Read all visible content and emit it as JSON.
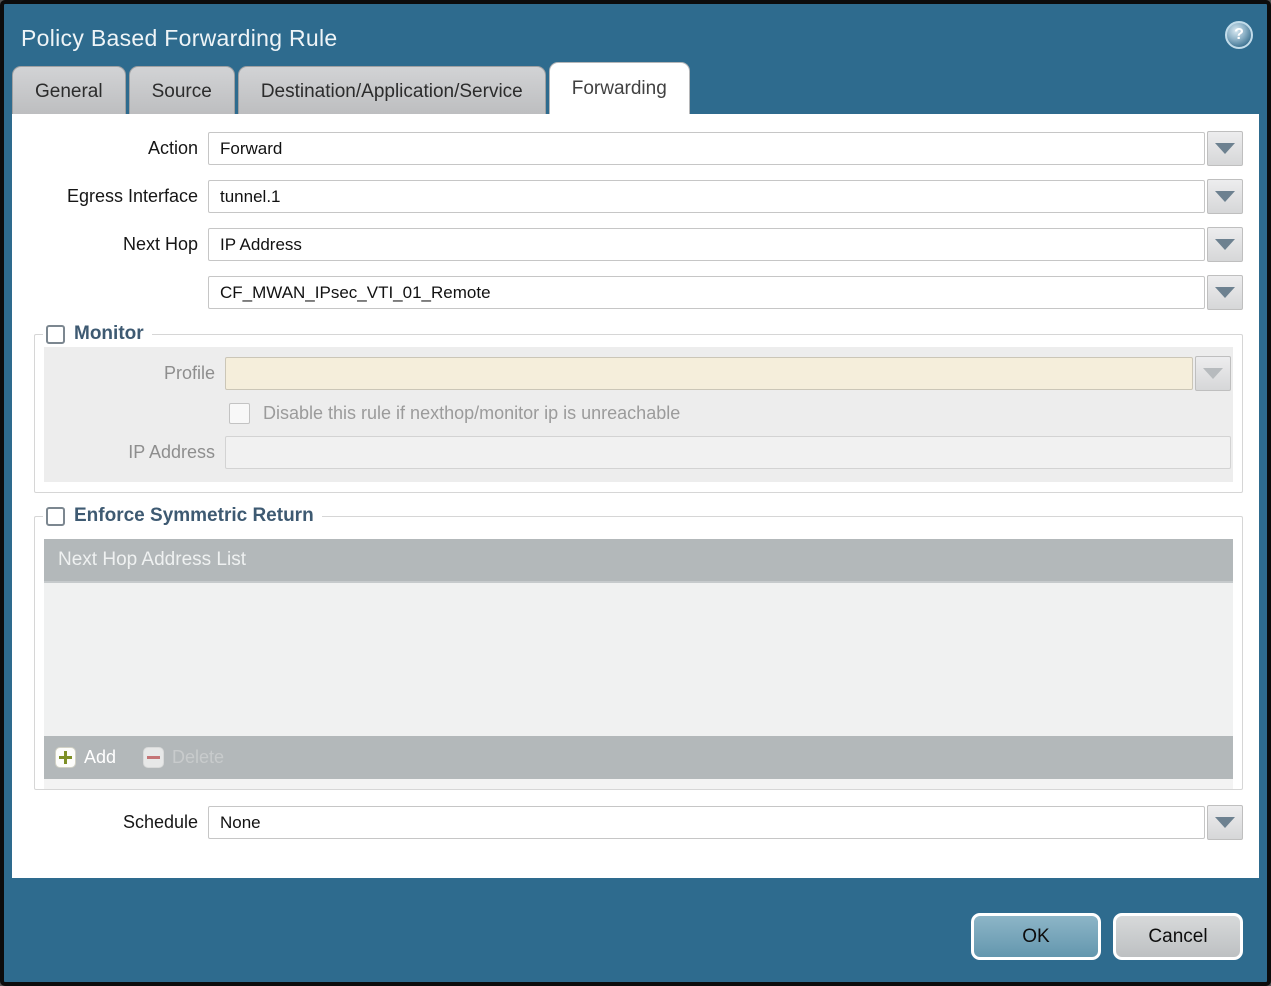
{
  "window": {
    "title": "Policy Based Forwarding Rule",
    "help_glyph": "?"
  },
  "tabs": [
    {
      "label": "General",
      "active": false
    },
    {
      "label": "Source",
      "active": false
    },
    {
      "label": "Destination/Application/Service",
      "active": false
    },
    {
      "label": "Forwarding",
      "active": true
    }
  ],
  "form": {
    "action": {
      "label": "Action",
      "value": "Forward"
    },
    "egress": {
      "label": "Egress Interface",
      "value": "tunnel.1"
    },
    "next_hop": {
      "label": "Next Hop",
      "value": "IP Address"
    },
    "next_hop_address": {
      "value": "CF_MWAN_IPsec_VTI_01_Remote"
    },
    "schedule": {
      "label": "Schedule",
      "value": "None"
    }
  },
  "monitor": {
    "legend": "Monitor",
    "checked": false,
    "profile": {
      "label": "Profile",
      "value": "",
      "disabled": true
    },
    "disable_rule": {
      "label": "Disable this rule if nexthop/monitor ip is unreachable",
      "checked": false,
      "disabled": true
    },
    "ip_address": {
      "label": "IP Address",
      "value": "",
      "disabled": true
    }
  },
  "symmetric": {
    "legend": "Enforce Symmetric Return",
    "checked": false,
    "table": {
      "header": "Next Hop Address List",
      "rows": []
    },
    "add_label": "Add",
    "delete_label": "Delete",
    "delete_disabled": true
  },
  "footer": {
    "ok": "OK",
    "cancel": "Cancel"
  },
  "colors": {
    "titlebar_teal": "#2e6b8e",
    "active_tab": "#ffffff",
    "inactive_tab": "#c5c6c8",
    "legend_text": "#3e5a72",
    "disabled_profile_field": "#f5eedb",
    "table_gray": "#b3b8ba",
    "add_plus_green": "#7e9026",
    "delete_minus_red": "#c47476",
    "ok_button": "#6da3ba",
    "cancel_button": "#c9cccd"
  }
}
